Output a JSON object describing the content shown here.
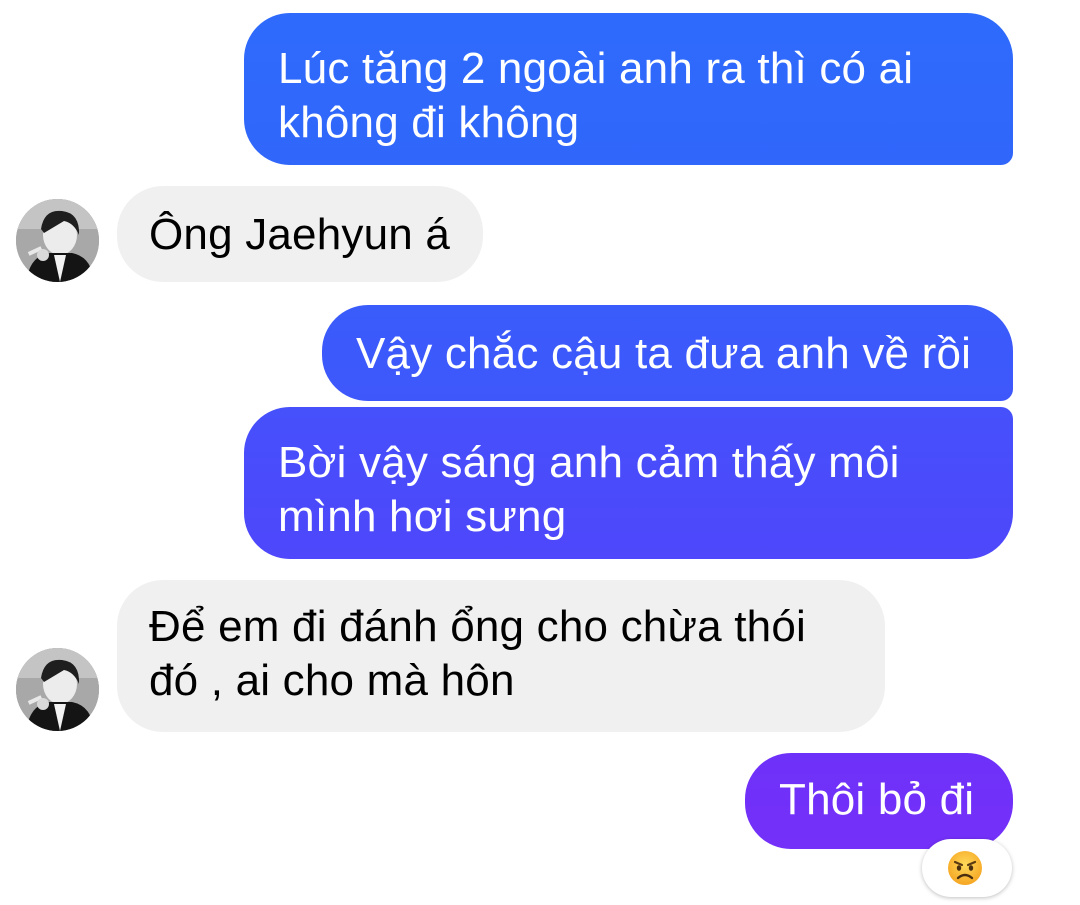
{
  "messages": [
    {
      "direction": "outgoing",
      "text": "Lúc tăng 2 ngoài anh ra thì có ai không đi không"
    },
    {
      "direction": "incoming",
      "text": "Ông Jaehyun á"
    },
    {
      "direction": "outgoing",
      "text": "Vậy chắc cậu ta đưa anh về rồi"
    },
    {
      "direction": "outgoing",
      "text": "Bời vậy sáng anh cảm thấy môi mình hơi sưng"
    },
    {
      "direction": "incoming",
      "text": "Để em đi đánh ổng cho chừa thói đó , ai cho mà hôn"
    },
    {
      "direction": "outgoing",
      "text": "Thôi bỏ đi",
      "reaction": "angry-face-icon"
    }
  ],
  "colors": {
    "incoming_bubble": "#f0f0f0",
    "outgoing_gradient_top": "#2e6bfc",
    "outgoing_gradient_bottom": "#7430f9"
  }
}
